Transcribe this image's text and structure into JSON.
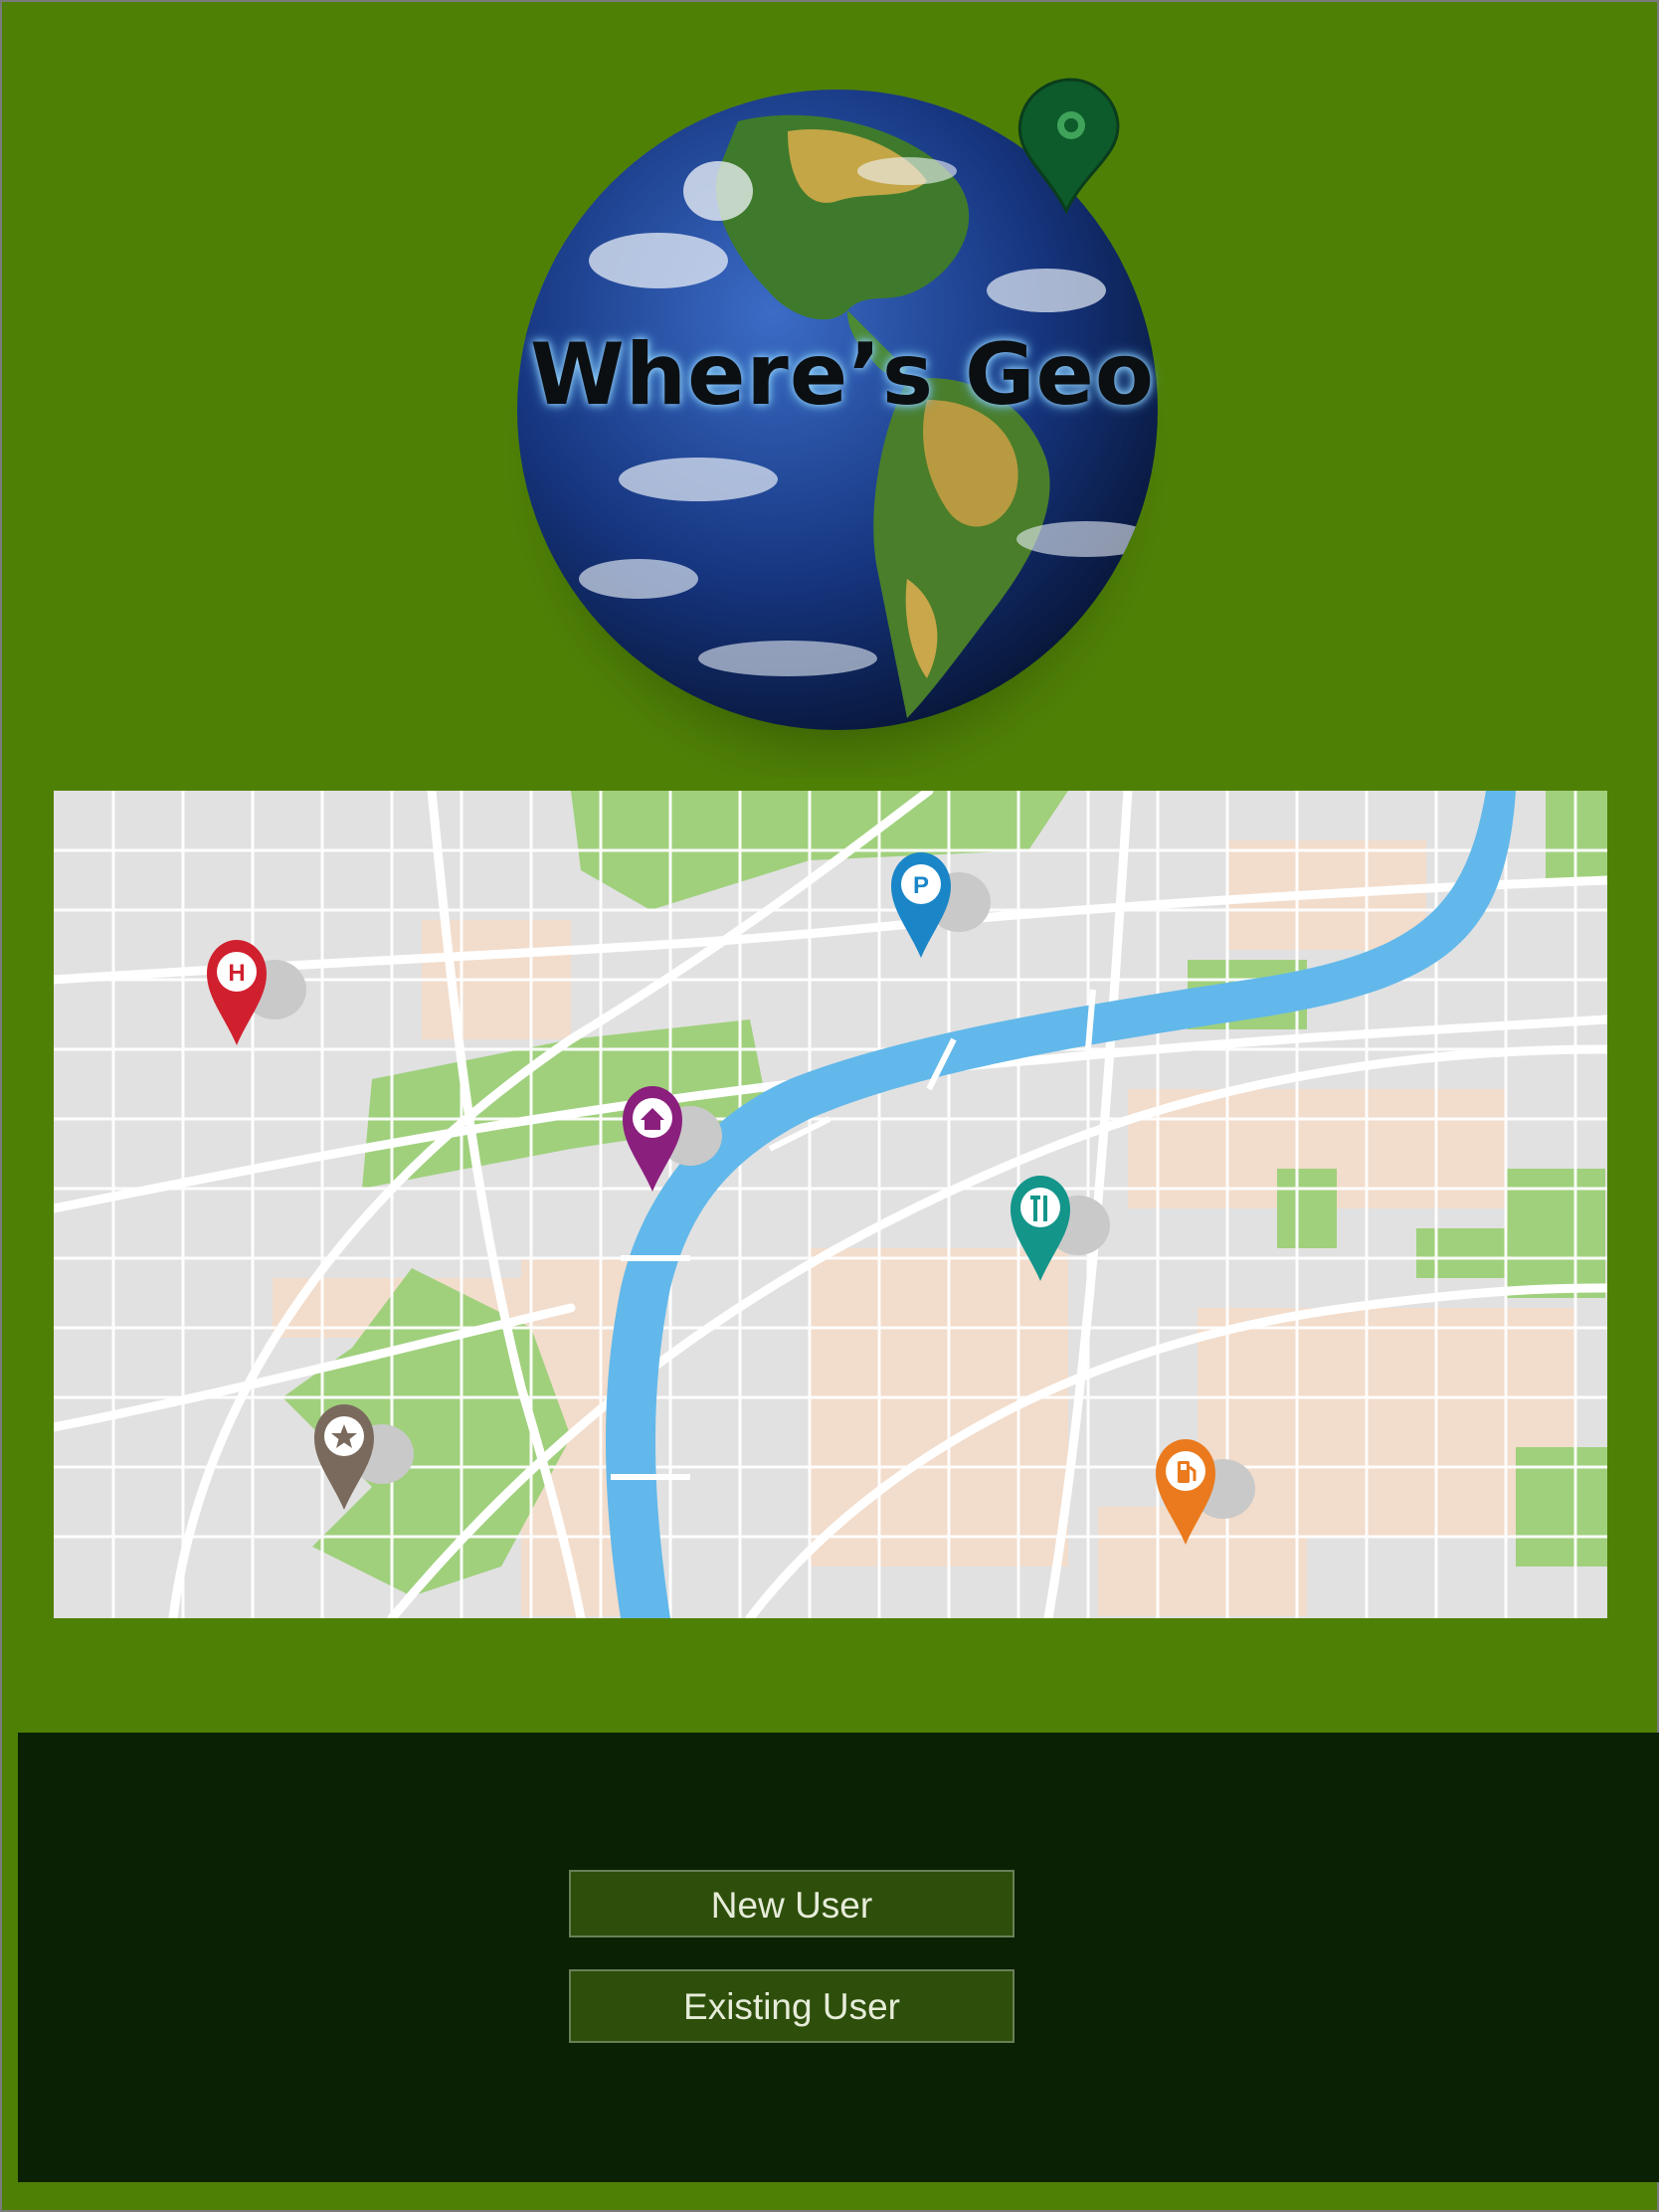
{
  "logo": {
    "text": "Where’s Geo"
  },
  "colors": {
    "background": "#4f8006",
    "bottom_panel": "#0a2103",
    "button_fill": "#2e4f0b",
    "button_border": "#6a7f57",
    "river": "#62b8ea",
    "park": "#9fd07c",
    "map_bg": "#e1e1e1"
  },
  "map_pins": [
    {
      "name": "hospital",
      "glyph": "H",
      "color": "#d0202e",
      "icon": "hospital-pin-icon"
    },
    {
      "name": "parking",
      "glyph": "P",
      "color": "#1a86c8",
      "icon": "parking-pin-icon"
    },
    {
      "name": "home",
      "glyph": "⌂",
      "color": "#8a1f7d",
      "icon": "home-pin-icon"
    },
    {
      "name": "restaurant",
      "glyph": "🍴",
      "color": "#13958a",
      "icon": "restaurant-pin-icon"
    },
    {
      "name": "favorite",
      "glyph": "★",
      "color": "#7a6a5d",
      "icon": "star-pin-icon"
    },
    {
      "name": "fuel",
      "glyph": "⛽",
      "color": "#ea7a1d",
      "icon": "fuel-pin-icon"
    }
  ],
  "buttons": {
    "new_user": "New User",
    "existing_user": "Existing User"
  }
}
